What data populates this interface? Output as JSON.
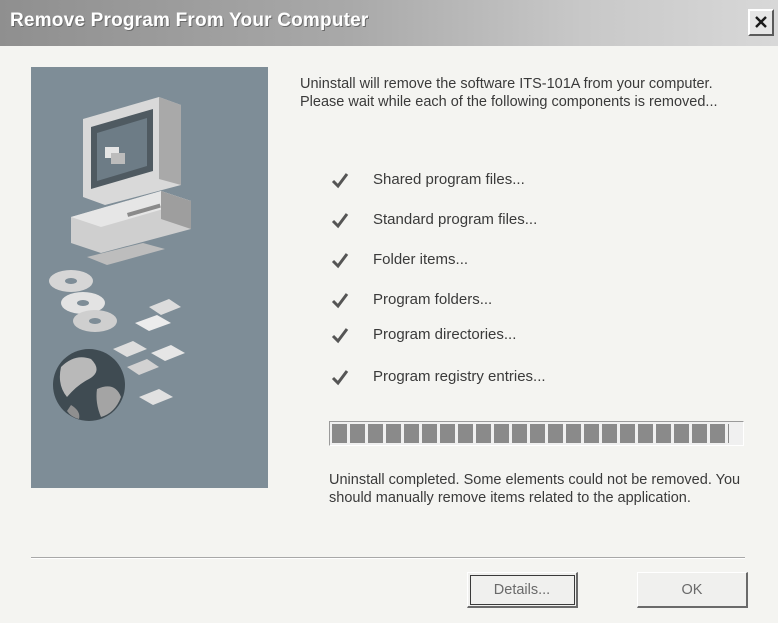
{
  "window": {
    "title": "Remove Program From Your Computer"
  },
  "intro_text": "Uninstall will remove the software ITS-101A from your computer. Please wait while each of the following components is removed...",
  "steps": [
    {
      "label": "Shared program files...",
      "done": true
    },
    {
      "label": "Standard program files...",
      "done": true
    },
    {
      "label": "Folder items...",
      "done": true
    },
    {
      "label": "Program folders...",
      "done": true
    },
    {
      "label": "Program directories...",
      "done": true
    },
    {
      "label": "Program registry entries...",
      "done": true
    }
  ],
  "progress": {
    "fraction": 0.97
  },
  "status_text": "Uninstall completed. Some elements could not be removed. You should manually remove items related to the application.",
  "buttons": {
    "details_label": "Details...",
    "ok_label": "OK"
  },
  "icons": {
    "close": "close-icon",
    "check": "checkmark-icon",
    "computer": "computer-icon",
    "disc": "cd-icon",
    "diskette": "floppy-icon",
    "globe": "globe-icon"
  },
  "colors": {
    "titlebar": "#9a9a9a",
    "art_panel": "#7e8d97",
    "progress": "#8a8a8a"
  }
}
